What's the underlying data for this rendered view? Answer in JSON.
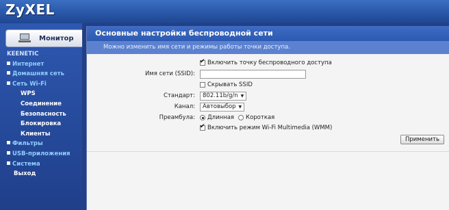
{
  "header": {
    "brand": "ZyXEL"
  },
  "sidebar": {
    "monitor_label": "Монитор",
    "items": [
      {
        "label": "KEENETIC",
        "kind": "brand"
      },
      {
        "label": "Интернет",
        "kind": "section"
      },
      {
        "label": "Домашняя сеть",
        "kind": "section"
      },
      {
        "label": "Сеть Wi-Fi",
        "kind": "section"
      },
      {
        "label": "WPS",
        "kind": "sub"
      },
      {
        "label": "Соединение",
        "kind": "sub"
      },
      {
        "label": "Безопасность",
        "kind": "sub"
      },
      {
        "label": "Блокировка",
        "kind": "sub"
      },
      {
        "label": "Клиенты",
        "kind": "sub"
      },
      {
        "label": "Фильтры",
        "kind": "section"
      },
      {
        "label": "USB-приложения",
        "kind": "section"
      },
      {
        "label": "Система",
        "kind": "section"
      },
      {
        "label": "Выход",
        "kind": "exit"
      }
    ]
  },
  "panel": {
    "title": "Основные настройки беспроводной сети",
    "subtitle": "Можно изменить имя сети и режимы работы точки доступа."
  },
  "form": {
    "enable_ap_label": "Включить точку беспроводного доступа",
    "enable_ap_checked": true,
    "ssid_label": "Имя сети (SSID):",
    "ssid_value": "",
    "hide_ssid_label": "Скрывать SSID",
    "hide_ssid_checked": false,
    "standard_label": "Стандарт:",
    "standard_value": "802.11b/g/n",
    "channel_label": "Канал:",
    "channel_value": "Автовыбор",
    "preamble_label": "Преамбула:",
    "preamble_long": "Длинная",
    "preamble_short": "Короткая",
    "preamble_selected": "long",
    "wmm_label": "Включить режим Wi-Fi Multimedia (WMM)",
    "wmm_checked": true,
    "apply_label": "Применить"
  }
}
